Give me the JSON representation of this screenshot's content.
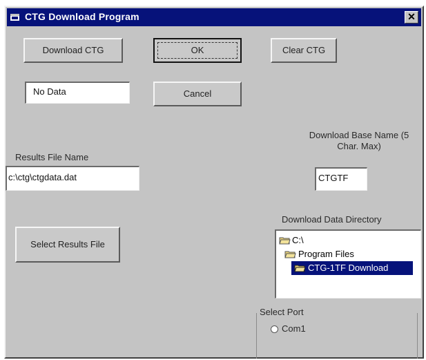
{
  "window": {
    "title": "CTG Download Program",
    "close_glyph": "✕"
  },
  "buttons": {
    "download": "Download CTG",
    "ok": "OK",
    "clear": "Clear CTG",
    "cancel": "Cancel",
    "select_results": "Select Results File"
  },
  "status": {
    "value": "No Data"
  },
  "results": {
    "label": "Results File Name",
    "value": "c:\\ctg\\ctgdata.dat"
  },
  "base_name": {
    "label": "Download Base Name (5 Char. Max)",
    "value": "CTGTF"
  },
  "directory": {
    "label": "Download Data Directory",
    "items": [
      {
        "label": "C:\\",
        "icon": "open-folder-icon"
      },
      {
        "label": "Program Files",
        "icon": "open-folder-icon"
      },
      {
        "label": "CTG-1TF Download",
        "icon": "open-folder-icon",
        "selected": true
      }
    ]
  },
  "port": {
    "label": "Select Port",
    "options": [
      {
        "label": "Com1",
        "selected": false
      }
    ]
  },
  "colors": {
    "titlebar": "#06127a",
    "face": "#c4c4c4",
    "selection": "#06127a"
  }
}
